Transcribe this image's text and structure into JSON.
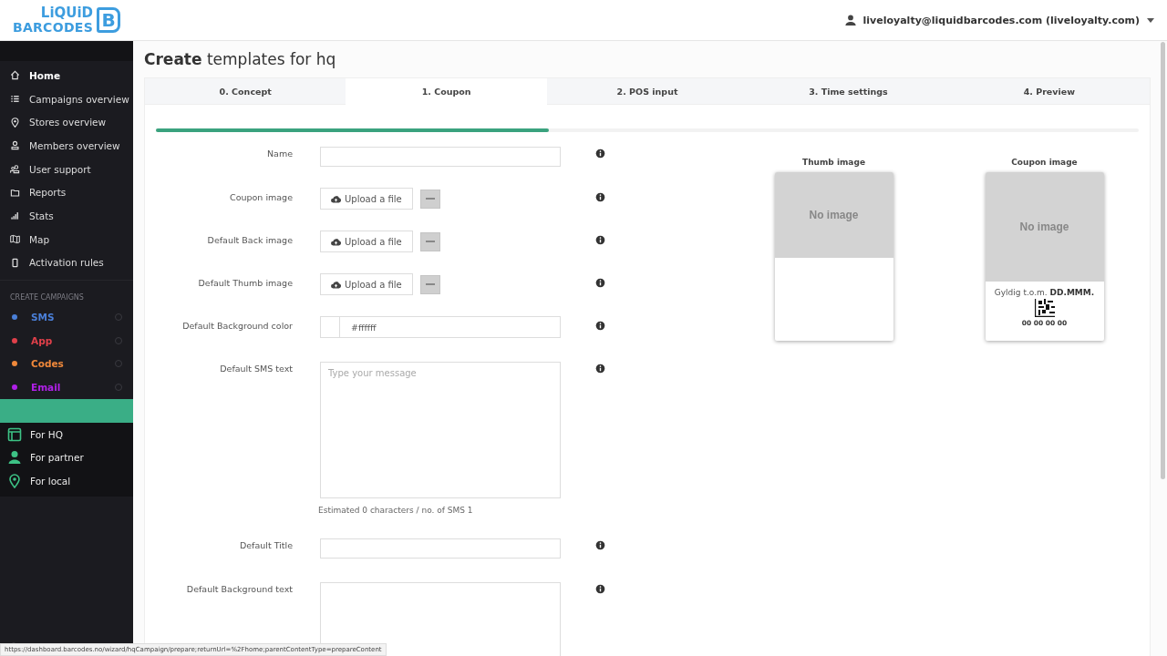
{
  "logo": {
    "line_1": "LiQUiD",
    "line_2": "BARCODES",
    "mark": "B"
  },
  "user_menu": {
    "label": "liveloyalty@liquidbarcodes.com (liveloyalty.com)"
  },
  "sidebar": {
    "items": [
      {
        "label": "Home",
        "selected": true
      },
      {
        "label": "Campaigns overview",
        "selected": false
      },
      {
        "label": "Stores overview",
        "selected": false
      },
      {
        "label": "Members overview",
        "selected": false
      },
      {
        "label": "User support",
        "selected": false
      },
      {
        "label": "Reports",
        "selected": false
      },
      {
        "label": "Stats",
        "selected": false
      },
      {
        "label": "Map",
        "selected": false
      },
      {
        "label": "Activation rules",
        "selected": false
      }
    ],
    "section_title": "CREATE CAMPAIGNS",
    "campaigns": [
      {
        "label": "SMS",
        "color": "#4a7fd8"
      },
      {
        "label": "App",
        "color": "#e0404a"
      },
      {
        "label": "Codes",
        "color": "#f0883a"
      },
      {
        "label": "Email",
        "color": "#b020e8"
      }
    ],
    "templates": {
      "children": [
        {
          "label": "For HQ"
        },
        {
          "label": "For partner"
        },
        {
          "label": "For local"
        }
      ]
    }
  },
  "page": {
    "title_bold": "Create",
    "title_rest": "templates for hq"
  },
  "tabs": [
    {
      "label": "0. Concept",
      "selected": false
    },
    {
      "label": "1. Coupon",
      "selected": true
    },
    {
      "label": "2. POS input",
      "selected": false
    },
    {
      "label": "3. Time settings",
      "selected": false
    },
    {
      "label": "4. Preview",
      "selected": false
    }
  ],
  "progress": {
    "level": 0.4
  },
  "form": [
    {
      "label": "Name",
      "kind": "text"
    },
    {
      "label": "Coupon image",
      "kind": "upload",
      "button": "Upload a file"
    },
    {
      "label": "Default Back image",
      "kind": "upload",
      "button": "Upload a file"
    },
    {
      "label": "Default Thumb image",
      "kind": "upload",
      "button": "Upload a file"
    },
    {
      "label": "Default Background color",
      "kind": "color",
      "value": "#ffffff"
    },
    {
      "label": "Default SMS text",
      "kind": "textarea",
      "placeholder": "Type your message",
      "note": "Estimated 0 characters / no. of SMS 1"
    },
    {
      "label": "Default Title",
      "kind": "text"
    },
    {
      "label": "Default Background text",
      "kind": "textarea"
    }
  ],
  "previews": [
    {
      "title": "Thumb image",
      "empty_text": "No image",
      "kind": "thumb"
    },
    {
      "title": "Coupon image",
      "empty_text": "No image",
      "kind": "coupon",
      "valid_label": "Gyldig t.o.m.",
      "valid_date": "DD.MMM.",
      "code": "00 00 00 00"
    }
  ],
  "status_url": "https://dashboard.barcodes.no/wizard/hqCampaign/prepare;returnUrl=%2Fhome;parentContentType=prepareContent"
}
